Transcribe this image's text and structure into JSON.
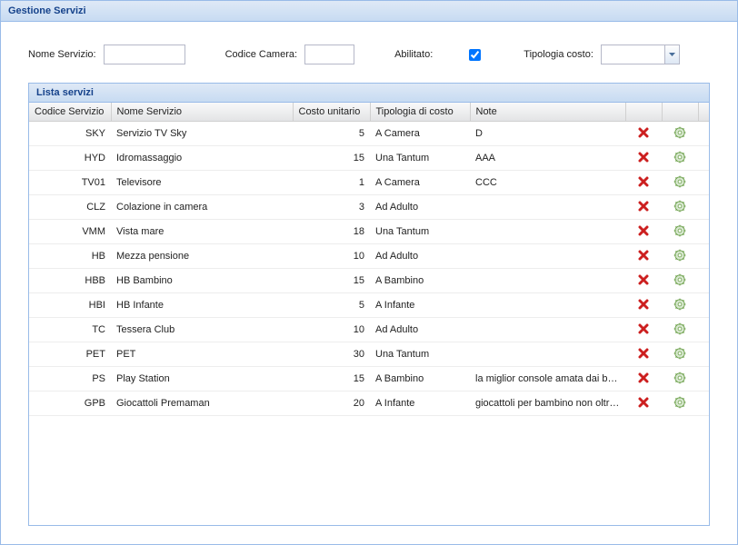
{
  "panel": {
    "title": "Gestione Servizi"
  },
  "filters": {
    "nome_servizio_label": "Nome Servizio:",
    "nome_servizio_value": "",
    "codice_camera_label": "Codice Camera:",
    "codice_camera_value": "",
    "abilitato_label": "Abilitato:",
    "abilitato_checked": true,
    "tipologia_costo_label": "Tipologia costo:",
    "tipologia_costo_value": ""
  },
  "grid": {
    "title": "Lista servizi",
    "headers": {
      "code": "Codice Servizio",
      "name": "Nome Servizio",
      "cost": "Costo unitario",
      "type": "Tipologia di costo",
      "note": "Note"
    },
    "rows": [
      {
        "code": "SKY",
        "name": "Servizio TV Sky",
        "cost": "5",
        "type": "A Camera",
        "note": "D"
      },
      {
        "code": "HYD",
        "name": "Idromassaggio",
        "cost": "15",
        "type": "Una Tantum",
        "note": "AAA"
      },
      {
        "code": "TV01",
        "name": "Televisore",
        "cost": "1",
        "type": "A Camera",
        "note": "CCC"
      },
      {
        "code": "CLZ",
        "name": "Colazione in camera",
        "cost": "3",
        "type": "Ad Adulto",
        "note": ""
      },
      {
        "code": "VMM",
        "name": "Vista mare",
        "cost": "18",
        "type": "Una Tantum",
        "note": ""
      },
      {
        "code": "HB",
        "name": "Mezza pensione",
        "cost": "10",
        "type": "Ad Adulto",
        "note": ""
      },
      {
        "code": "HBB",
        "name": "HB Bambino",
        "cost": "15",
        "type": "A Bambino",
        "note": ""
      },
      {
        "code": "HBI",
        "name": "HB Infante",
        "cost": "5",
        "type": "A Infante",
        "note": ""
      },
      {
        "code": "TC",
        "name": "Tessera Club",
        "cost": "10",
        "type": "Ad Adulto",
        "note": ""
      },
      {
        "code": "PET",
        "name": "PET",
        "cost": "30",
        "type": "Una Tantum",
        "note": ""
      },
      {
        "code": "PS",
        "name": "Play Station",
        "cost": "15",
        "type": "A Bambino",
        "note": "la miglior console amata dai ba…"
      },
      {
        "code": "GPB",
        "name": "Giocattoli Premaman",
        "cost": "20",
        "type": "A Infante",
        "note": "giocattoli per bambino non oltr…"
      }
    ]
  },
  "icons": {
    "delete": "delete-icon",
    "gear": "gear-icon",
    "dropdown": "chevron-down-icon"
  }
}
